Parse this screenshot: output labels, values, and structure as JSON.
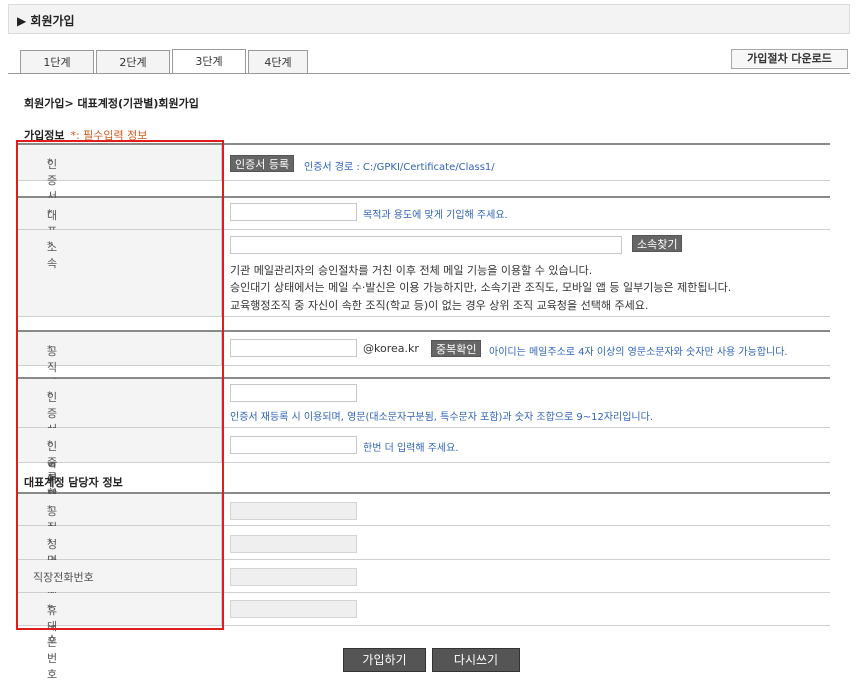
{
  "page": {
    "title": "▶ 회원가입"
  },
  "tabs": [
    {
      "label": "1단계"
    },
    {
      "label": "2단계"
    },
    {
      "label": "3단계"
    },
    {
      "label": "4단계"
    }
  ],
  "download_label": "가입절차 다운로드",
  "breadcrumb": "회원가입> 대표계정(기관별)회원가입",
  "section": {
    "title": "가입정보",
    "required_note": "*: 필수입력 정보"
  },
  "fields": {
    "cert": {
      "label": "인증서",
      "button": "인증서 등록",
      "hint": "인증서 경로 : C:/GPKI/Certificate/Class1/"
    },
    "rep_name": {
      "label": "대표계정명",
      "hint": "목적과 용도에 맞게 기입해 주세요."
    },
    "affiliation": {
      "label": "소속",
      "button": "소속찾기",
      "notes": [
        "기관 메일관리자의 승인절차를 거친 이후 전체 메일 기능을 이용할 수 있습니다.",
        "승인대기 상태에서는 메일 수·발신은 이용 가능하지만, 소속기관 조직도, 모바일 앱 등 일부기능은 제한됩니다.",
        "교육행정조직 중 자신이 속한 조직(학교 등)이 없는 경우 상위 조직 교육청을 선택해 주세요."
      ]
    },
    "email_id": {
      "label": "공직자통합메일 아이디",
      "domain": "@korea.kr",
      "button": "중복확인",
      "hint": "아이디는 메일주소로 4자 이상의 영문소문자와 숫자만 사용 가능합니다."
    },
    "reg_pw": {
      "label": "인증서 재등록 확인번호",
      "hint": "인증서 재등록 시 이용되며, 영문(대소문자구분됨, 특수문자 포함)과 숫자 조합으로 9~12자리입니다."
    },
    "reg_pw_confirm": {
      "label": "인증서 재등록 확인번호 확인",
      "hint": "한번 더 입력해 주세요."
    }
  },
  "manager": {
    "title": "대표계정 담당자 정보",
    "email": {
      "label": "공직자통합메일 주소"
    },
    "name": {
      "label": "성명"
    },
    "phone": {
      "label": "직장전화번호"
    },
    "mobile": {
      "label": "휴대폰번호"
    }
  },
  "buttons": {
    "submit": "가입하기",
    "reset": "다시쓰기"
  },
  "colors": {
    "highlight": "#e01c1c",
    "hint": "#2e63b8",
    "required": "#e07a2a"
  }
}
